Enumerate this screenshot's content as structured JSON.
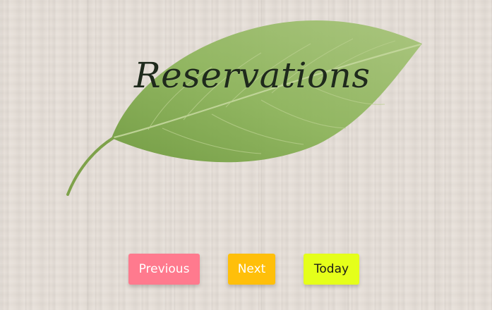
{
  "header": {
    "title": "Reservations"
  },
  "controls": {
    "previous_label": "Previous",
    "next_label": "Next",
    "today_label": "Today"
  },
  "icons": {
    "hero_image": "leaf-icon"
  },
  "colors": {
    "previous_button": "#ff7a8e",
    "next_button": "#ffbf0a",
    "today_button": "#e5ff1a",
    "leaf": "#8fb35a",
    "background": "#e6dfd8"
  }
}
